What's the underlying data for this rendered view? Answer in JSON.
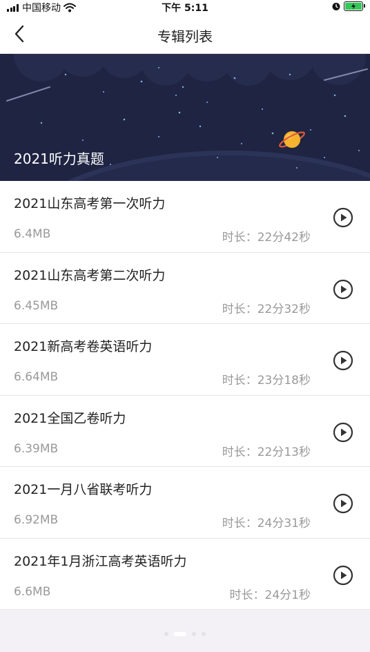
{
  "status_bar": {
    "carrier": "中国移动",
    "time": "下午 5:11"
  },
  "nav": {
    "title": "专辑列表",
    "back_icon": "chevron-left-icon"
  },
  "banner": {
    "title": "2021听力真题"
  },
  "items": [
    {
      "title": "2021山东高考第一次听力",
      "size": "6.4MB",
      "duration": "时长：22分42秒"
    },
    {
      "title": "2021山东高考第二次听力",
      "size": "6.45MB",
      "duration": "时长：22分32秒"
    },
    {
      "title": "2021新高考卷英语听力",
      "size": "6.64MB",
      "duration": "时长：23分18秒"
    },
    {
      "title": "2021全国乙卷听力",
      "size": "6.39MB",
      "duration": "时长：22分13秒"
    },
    {
      "title": "2021一月八省联考听力",
      "size": "6.92MB",
      "duration": "时长：24分31秒"
    },
    {
      "title": "2021年1月浙江高考英语听力",
      "size": "6.6MB",
      "duration": "时长：24分1秒"
    }
  ],
  "colors": {
    "banner_bg": "#1f2442",
    "planet": "#f5b22f",
    "text_primary": "#222222",
    "text_secondary": "#999999",
    "battery": "#34c759"
  }
}
